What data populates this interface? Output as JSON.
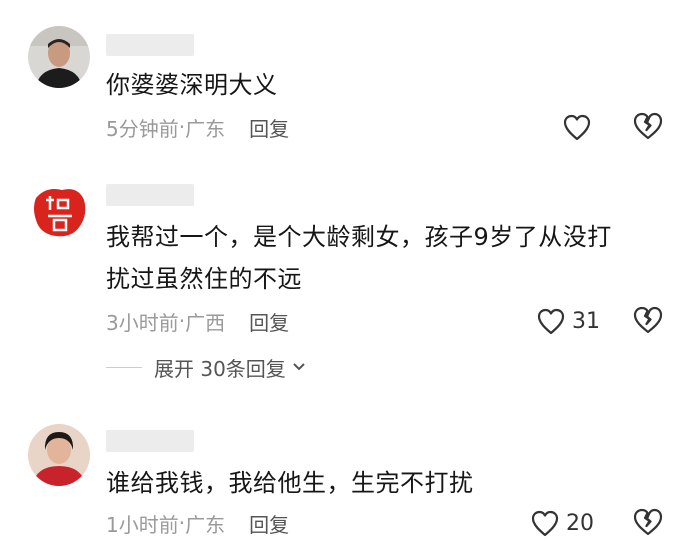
{
  "comments": [
    {
      "text": "你婆婆深明大义",
      "time": "5分钟前",
      "region": "广东",
      "reply_label": "回复",
      "likes": ""
    },
    {
      "text_line1": "我帮过一个，是个大龄剩女，孩子9岁了从没打",
      "text_line2": "扰过虽然住的不远",
      "time": "3小时前",
      "region": "广西",
      "reply_label": "回复",
      "likes": "31",
      "expand_label": "展开 30条回复"
    },
    {
      "text": "谁给我钱，我给他生，生完不打扰",
      "time": "1小时前",
      "region": "广东",
      "reply_label": "回复",
      "likes": "20"
    }
  ],
  "separator": " · ",
  "icons": {
    "like": "heart-outline-icon",
    "dislike": "broken-heart-icon",
    "expand": "chevron-down-icon"
  },
  "colors": {
    "text": "#161616",
    "meta": "#9a9a9a",
    "reply": "#555555",
    "avatar2_red": "#d8241c",
    "avatar3_red": "#c8222a"
  }
}
